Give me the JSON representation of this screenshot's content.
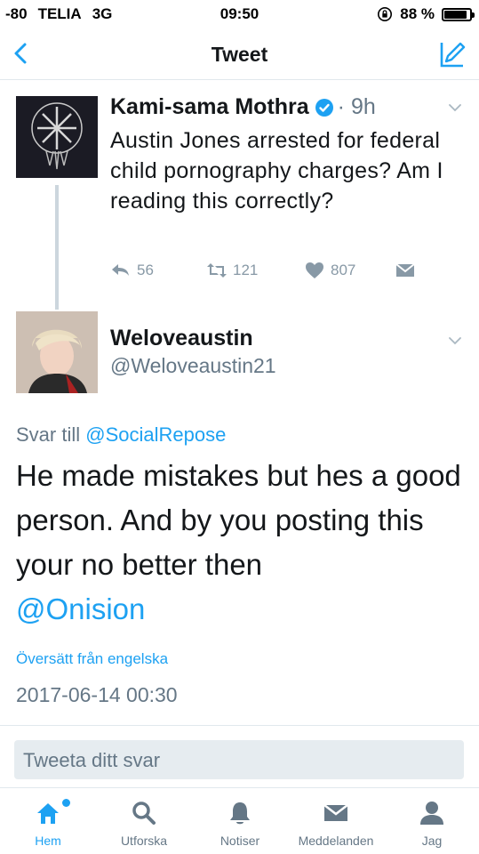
{
  "status_bar": {
    "signal": "-80",
    "carrier": "TELIA",
    "network": "3G",
    "time": "09:50",
    "battery_text": "88 %",
    "battery_level": 0.88
  },
  "nav": {
    "title": "Tweet",
    "back_icon": "chevron-left-icon",
    "compose_icon": "compose-icon"
  },
  "tweet1": {
    "name": "Kami-sama Mothra",
    "time": "9h",
    "text": "Austin Jones arrested for federal child pornography charges? Am I reading this correctly?",
    "replies": "56",
    "retweets": "121",
    "likes": "807"
  },
  "tweet2": {
    "name": "Weloveaustin",
    "handle": "@Weloveaustin21",
    "reply_prefix": "Svar till",
    "reply_mention": "@SocialRepose",
    "text_main": "He made mistakes but hes a good person. And by you posting this your no better then",
    "text_mention": "@Onision",
    "translate": "Översätt från engelska",
    "timestamp": "2017-06-14 00:30"
  },
  "reply_box": {
    "placeholder": "Tweeta ditt svar"
  },
  "tabs": [
    {
      "label": "Hem",
      "icon": "home-icon",
      "active": true
    },
    {
      "label": "Utforska",
      "icon": "search-icon",
      "active": false
    },
    {
      "label": "Notiser",
      "icon": "bell-icon",
      "active": false
    },
    {
      "label": "Meddelanden",
      "icon": "mail-icon",
      "active": false
    },
    {
      "label": "Jag",
      "icon": "person-icon",
      "active": false
    }
  ],
  "colors": {
    "accent": "#1da1f2",
    "muted": "#657786",
    "action_gray": "#8899a6"
  }
}
